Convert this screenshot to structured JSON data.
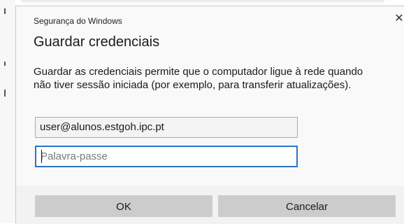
{
  "window": {
    "title": "Segurança do Windows",
    "close_icon": "close-icon"
  },
  "dialog": {
    "heading": "Guardar credenciais",
    "description": "Guardar as credenciais permite que o computador ligue à rede quando não tiver sessão iniciada (por exemplo, para transferir atualizações)."
  },
  "form": {
    "username_value": "user@alunos.estgoh.ipc.pt",
    "password_value": "",
    "password_placeholder": "Palavra-passe"
  },
  "buttons": {
    "ok_label": "OK",
    "cancel_label": "Cancelar"
  },
  "colors": {
    "focus_border": "#2b74c5",
    "button_bg": "#cccccc",
    "dialog_bg": "#f9f9f9"
  }
}
